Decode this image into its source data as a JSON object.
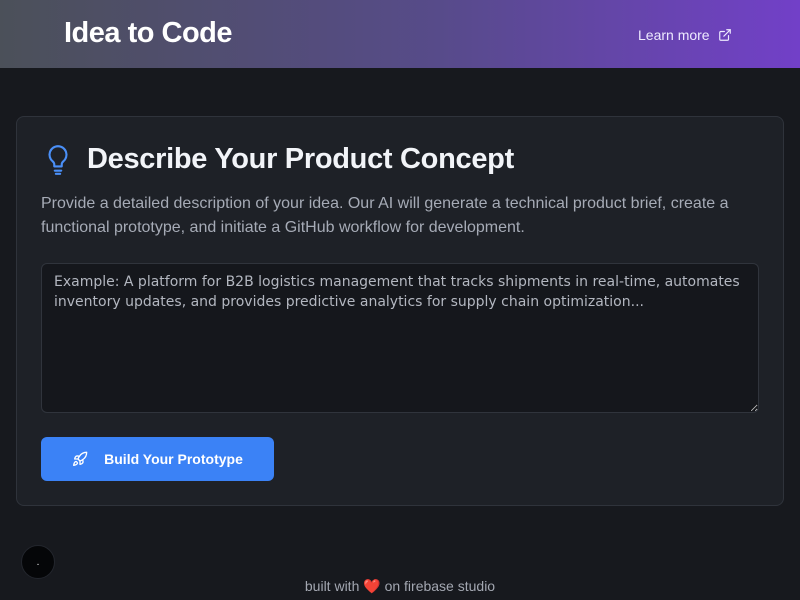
{
  "header": {
    "brand": "Idea to Code",
    "learn_more": "Learn more",
    "gradient_colors": [
      "#4b5059",
      "#7240c8"
    ]
  },
  "card": {
    "icon": "lightbulb-icon",
    "title": "Describe Your Product Concept",
    "description": "Provide a detailed description of your idea. Our AI will generate a technical product brief, create a functional prototype, and initiate a GitHub workflow for development.",
    "textarea": {
      "value": "",
      "placeholder": "Example: A platform for B2B logistics management that tracks shipments in real-time, automates inventory updates, and provides predictive analytics for supply chain optimization..."
    },
    "button": {
      "icon": "rocket-icon",
      "label": "Build Your Prototype",
      "color": "#3b82f6"
    }
  },
  "floating_dot": {
    "label": "."
  },
  "footer": {
    "prefix": "built with",
    "heart": "❤️",
    "suffix": "on firebase studio"
  }
}
